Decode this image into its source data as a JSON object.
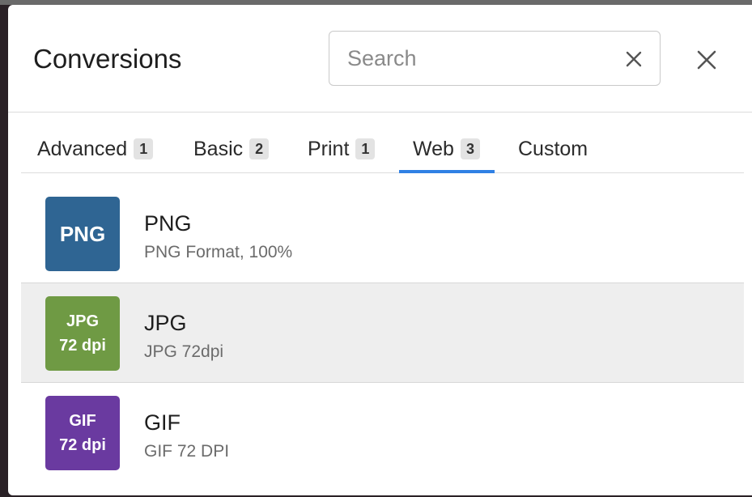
{
  "dialog": {
    "title": "Conversions",
    "search": {
      "placeholder": "Search",
      "value": ""
    }
  },
  "tabs": [
    {
      "label": "Advanced",
      "count": "1"
    },
    {
      "label": "Basic",
      "count": "2"
    },
    {
      "label": "Print",
      "count": "1"
    },
    {
      "label": "Web",
      "count": "3",
      "active": true
    },
    {
      "label": "Custom"
    }
  ],
  "items": [
    {
      "thumb_line1": "PNG",
      "thumb_line2": "",
      "name": "PNG",
      "description": "PNG Format, 100%",
      "thumb_color": "#2f6593"
    },
    {
      "thumb_line1": "JPG",
      "thumb_line2": "72 dpi",
      "name": "JPG",
      "description": "JPG 72dpi",
      "thumb_color": "#6f9a44",
      "selected": true
    },
    {
      "thumb_line1": "GIF",
      "thumb_line2": "72 dpi",
      "name": "GIF",
      "description": "GIF 72 DPI",
      "thumb_color": "#6a3aa0"
    }
  ],
  "colors": {
    "accent": "#2f80e4",
    "selected_row": "#eeeeee"
  },
  "icons": {
    "clear": "close-icon",
    "close": "close-icon"
  }
}
